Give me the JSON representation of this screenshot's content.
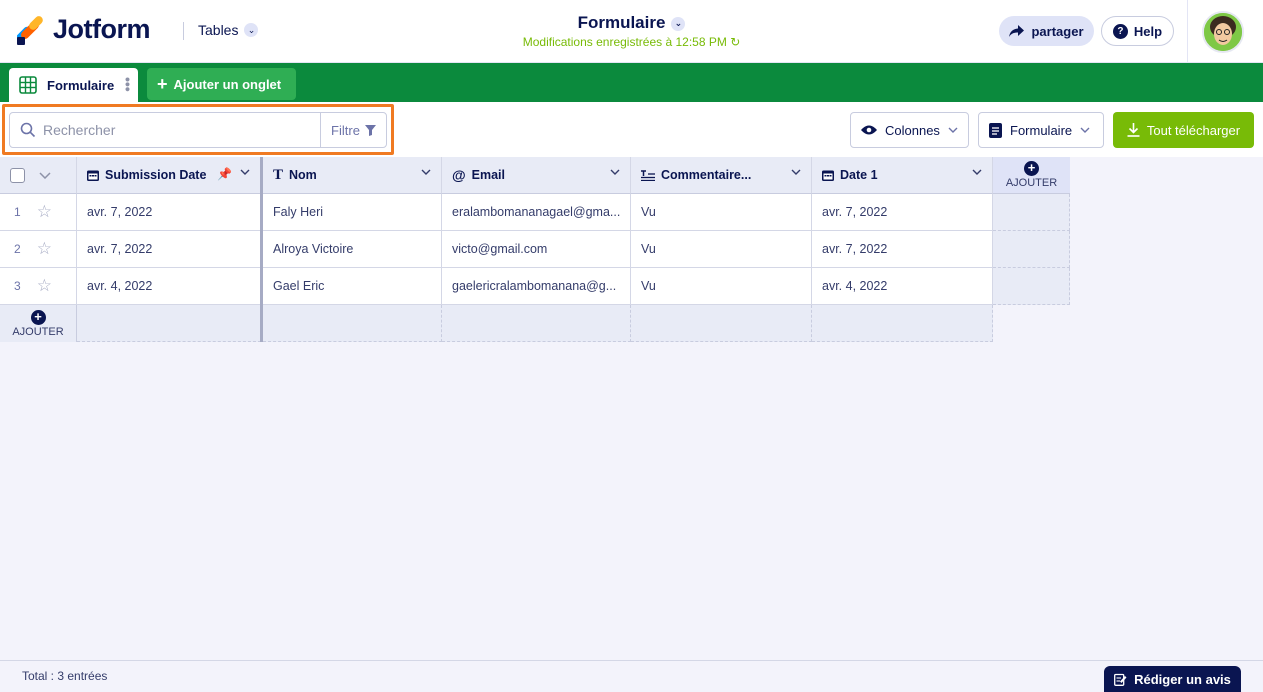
{
  "header": {
    "logo_text": "Jotform",
    "product_dropdown": "Tables",
    "form_title": "Formulaire",
    "save_status": "Modifications enregistrées à 12:58 PM",
    "share_label": "partager",
    "help_label": "Help"
  },
  "tabs": {
    "active_label": "Formulaire",
    "add_label": "Ajouter un onglet"
  },
  "toolbar": {
    "search_placeholder": "Rechercher",
    "filter_label": "Filtre",
    "columns_label": "Colonnes",
    "form_label": "Formulaire",
    "download_label": "Tout télécharger"
  },
  "table": {
    "columns": [
      {
        "label": "Submission Date",
        "icon": "calendar-icon"
      },
      {
        "label": "Nom",
        "icon": "text-icon"
      },
      {
        "label": "Email",
        "icon": "at-icon"
      },
      {
        "label": "Commentaire...",
        "icon": "paragraph-icon"
      },
      {
        "label": "Date 1",
        "icon": "calendar-icon"
      }
    ],
    "add_column_label": "AJOUTER",
    "add_row_label": "AJOUTER",
    "rows": [
      {
        "num": "1",
        "cells": [
          "avr. 7, 2022",
          "Faly Heri",
          "eralambomananagael@gma...",
          "Vu",
          "avr. 7, 2022"
        ]
      },
      {
        "num": "2",
        "cells": [
          "avr. 7, 2022",
          "Alroya Victoire",
          "victo@gmail.com",
          "Vu",
          "avr. 7, 2022"
        ]
      },
      {
        "num": "3",
        "cells": [
          "avr. 4, 2022",
          "Gael Eric",
          "gaelericralambomanana@g...",
          "Vu",
          "avr. 4, 2022"
        ]
      }
    ]
  },
  "footer": {
    "total": "Total : 3 entrées",
    "review_label": "Rédiger un avis"
  },
  "colors": {
    "brand_navy": "#0a1551",
    "tab_green": "#0b8a3d",
    "download_green": "#78bb07",
    "highlight_orange": "#f07a22"
  }
}
